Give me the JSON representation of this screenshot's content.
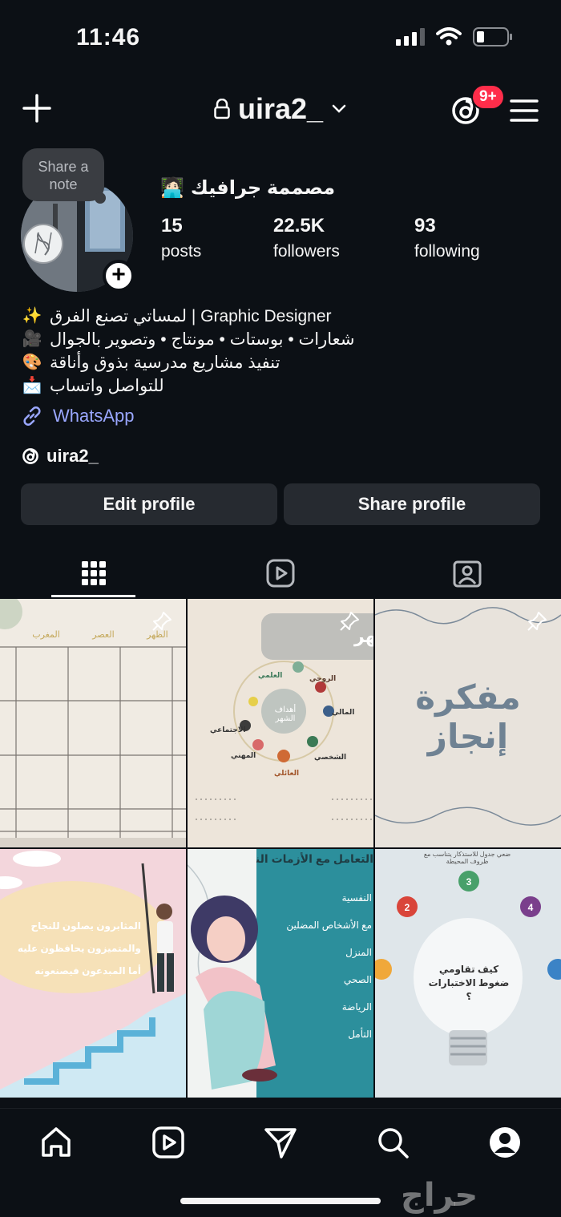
{
  "status": {
    "time": "11:46"
  },
  "header": {
    "username": "uira2_",
    "badge": "9+"
  },
  "note": {
    "text_line1": "Share a",
    "text_line2": "note"
  },
  "profile": {
    "display_name": "مصممة جرافيك",
    "display_emoji": "🧑🏻‍💻",
    "stats": [
      {
        "value": "15",
        "label": "posts"
      },
      {
        "value": "22.5K",
        "label": "followers"
      },
      {
        "value": "93",
        "label": "following"
      }
    ],
    "bio": [
      {
        "emoji": "✨",
        "text": "لمساتي تصنع الفرق | Graphic Designer"
      },
      {
        "emoji": "🎥",
        "text": "شعارات • بوستات • مونتاج • وتصوير بالجوال"
      },
      {
        "emoji": "🎨",
        "text": "تنفيذ مشاريع مدرسية بذوق وأناقة"
      },
      {
        "emoji": "📩",
        "text": "للتواصل واتساب"
      }
    ],
    "link": "WhatsApp",
    "threads_handle": "uira2_"
  },
  "buttons": {
    "edit": "Edit profile",
    "share": "Share profile"
  },
  "posts": {
    "p3_title": "مفكرة إنجاز",
    "p2_center": "أهداف الشهر",
    "p2_top": "شهر",
    "p2_labels": [
      "العلمي",
      "الروحي",
      "المالي",
      "الشخصي",
      "العائلي",
      "المهني",
      "الاجتماعي"
    ],
    "p1_headers": [
      "المغرب",
      "العصر",
      "الظهر"
    ],
    "p4_lines": [
      "المثابرون يصلون للنجاح",
      "والمتميزون يحافظون عليه",
      "أما المبدعون فيصنعونه"
    ],
    "p5_title": "التعامل مع الأزمات النفسية",
    "p5_items": [
      "النفسية",
      "مع الأشخاص المضلين",
      "المنزل",
      "الصحي",
      "الرياضة",
      "التأمل"
    ],
    "p6_center": "كيف تقاومي ضغوط الاختبارات ؟",
    "p6_nums": [
      "2",
      "3",
      "4"
    ],
    "p6_caption": "ضعي جدول للاستذكار يتناسب مع ظروف المحيطة"
  },
  "watermark": "حراج",
  "colors": {
    "bg": "#0c1015",
    "button": "#262a30",
    "link": "#9aa7ff",
    "badge": "#ff2d4a"
  }
}
